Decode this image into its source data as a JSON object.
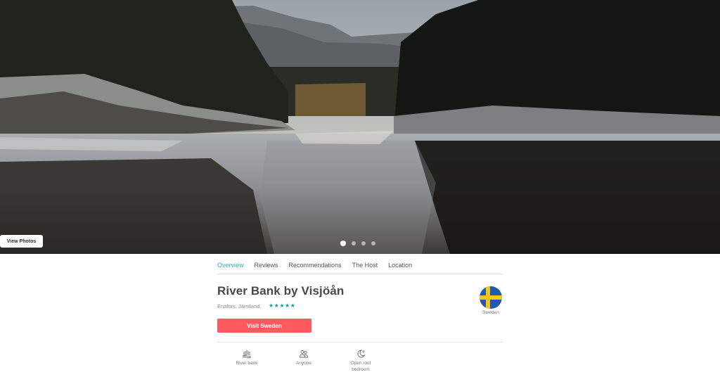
{
  "hero": {
    "view_photos_label": "View Photos",
    "slide_count": 4,
    "active_slide": 1
  },
  "nav": {
    "tabs": [
      {
        "label": "Overview",
        "active": true
      },
      {
        "label": "Reviews",
        "active": false
      },
      {
        "label": "Recommendations",
        "active": false
      },
      {
        "label": "The Host",
        "active": false
      },
      {
        "label": "Location",
        "active": false
      }
    ]
  },
  "listing": {
    "title": "River Bank by Visjöån",
    "location": "Enafors, Jämtland.",
    "rating_stars": "★★★★★",
    "rating": 5,
    "country": "Sweden",
    "cta_label": "Visit Sweden"
  },
  "features": [
    {
      "icon": "river-bank-icon",
      "label": "River bank"
    },
    {
      "icon": "people-icon",
      "label": "Anyone"
    },
    {
      "icon": "moon-star-icon",
      "label": "Open roof\nbedroom"
    }
  ],
  "colors": {
    "accent_teal": "#2db5b0",
    "cta_red": "#ff5a5f",
    "star_green": "#00a699",
    "flag_blue": "#1e5bb0",
    "flag_yellow": "#f7c716"
  }
}
